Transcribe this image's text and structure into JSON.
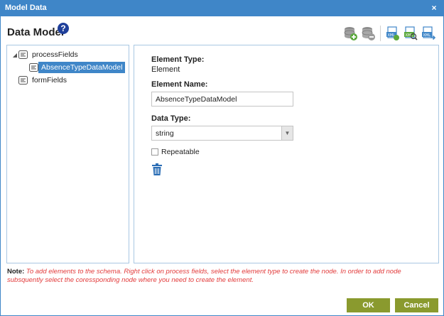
{
  "window": {
    "title": "Model Data",
    "close_glyph": "×"
  },
  "header": {
    "title": "Data Model",
    "help_glyph": "?"
  },
  "toolbar": {
    "icons": [
      "add-database-icon",
      "remove-database-icon",
      "export-xml-icon",
      "view-xml-icon",
      "import-xml-icon"
    ]
  },
  "tree": {
    "nodes": [
      {
        "label": "processFields",
        "expanded": true,
        "arrow": "◢"
      },
      {
        "label": "AbsenceTypeDataModel",
        "selected": true
      },
      {
        "label": "formFields"
      }
    ]
  },
  "properties": {
    "element_type_label": "Element Type:",
    "element_type_value": "Element",
    "element_name_label": "Element Name:",
    "element_name_value": "AbsenceTypeDataModel",
    "data_type_label": "Data Type:",
    "data_type_value": "string",
    "data_type_arrow": "▼",
    "repeatable_label": "Repeatable",
    "repeatable_checked": false
  },
  "note": {
    "label": "Note:",
    "text": "To add elements to the schema. Right click on process fields, select the element type to create the node. In order to add node subsquently select the coressponding node where you need to create the element."
  },
  "buttons": {
    "ok": "OK",
    "cancel": "Cancel"
  },
  "colors": {
    "accent": "#3f86c8",
    "button": "#8a9a2e",
    "note_text": "#e23b3b",
    "help_icon": "#1f3f9a"
  }
}
